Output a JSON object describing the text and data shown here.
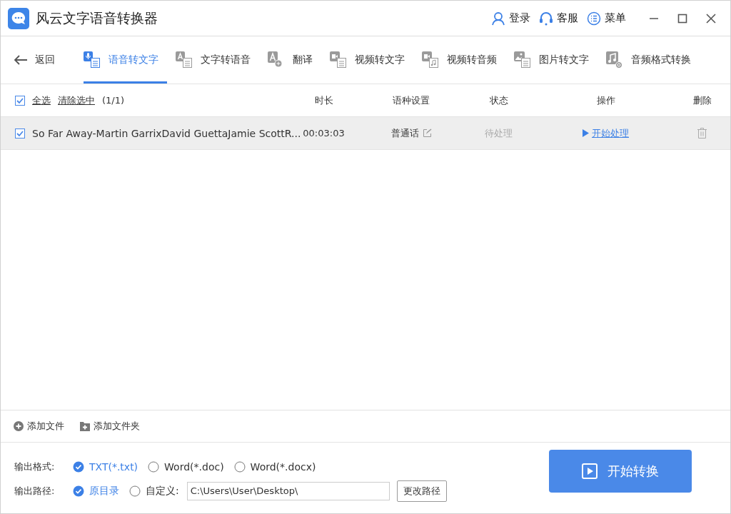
{
  "window": {
    "title": "风云文字语音转换器"
  },
  "header_actions": [
    {
      "label": "登录"
    },
    {
      "label": "客服"
    },
    {
      "label": "菜单"
    }
  ],
  "nav": {
    "back": "返回",
    "tabs": [
      {
        "label": "语音转文字",
        "selected": true
      },
      {
        "label": "文字转语音",
        "selected": false
      },
      {
        "label": "翻译",
        "selected": false
      },
      {
        "label": "视频转文字",
        "selected": false
      },
      {
        "label": "视频转音频",
        "selected": false
      },
      {
        "label": "图片转文字",
        "selected": false
      },
      {
        "label": "音频格式转换",
        "selected": false
      }
    ]
  },
  "list": {
    "select_all": {
      "label": "全选",
      "checked": true
    },
    "clear_selection": "清除选中",
    "count": "(1/1)",
    "columns": [
      "时长",
      "语种设置",
      "状态",
      "操作",
      "删除"
    ],
    "rows": [
      {
        "checked": true,
        "name": "So Far Away-Martin GarrixDavid GuettaJamie ScottR...",
        "duration": "00:03:03",
        "language": "普通话",
        "status": "待处理",
        "action": "开始处理"
      }
    ]
  },
  "add_actions": [
    "添加文件",
    "添加文件夹"
  ],
  "output": {
    "format_label": "输出格式:",
    "formats": [
      {
        "label": "TXT(*.txt)",
        "selected": true
      },
      {
        "label": "Word(*.doc)",
        "selected": false
      },
      {
        "label": "Word(*.docx)",
        "selected": false
      }
    ],
    "path_label": "输出路径:",
    "path_options": [
      {
        "label": "原目录",
        "selected": true
      },
      {
        "label": "自定义:",
        "selected": false
      }
    ],
    "path_value": "C:\\Users\\User\\Desktop\\",
    "change_path": "更改路径",
    "start": "开始转换"
  }
}
